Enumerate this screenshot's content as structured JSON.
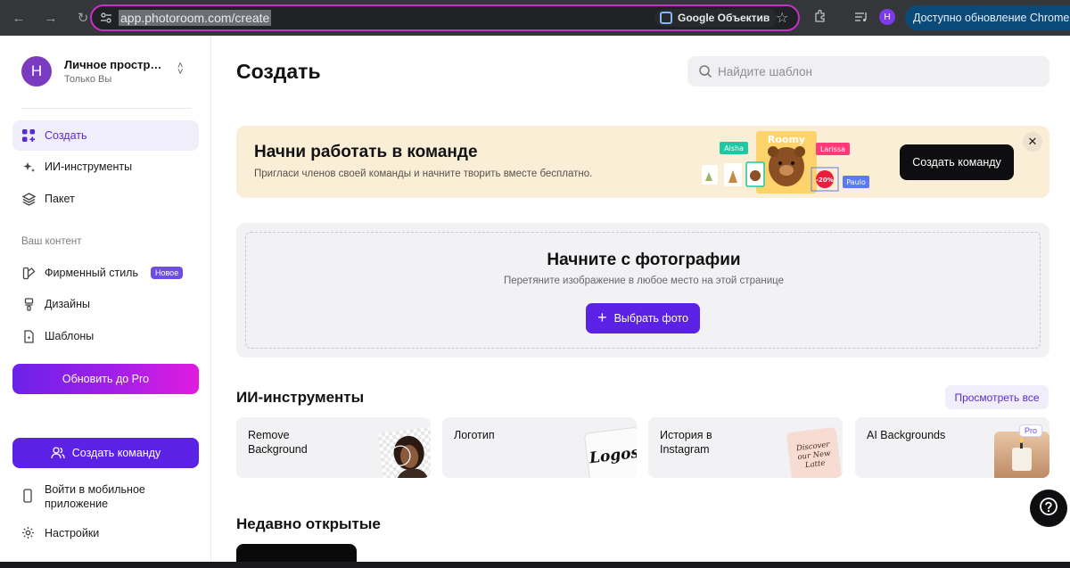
{
  "browser": {
    "url": "app.photoroom.com/create",
    "lens_label": "Google Объектив",
    "update_label": "Доступно обновление Chrome",
    "profile_initial": "H"
  },
  "workspace": {
    "avatar_initial": "H",
    "name": "Личное пространство",
    "sub": "Только Вы"
  },
  "sidebar": {
    "items": [
      {
        "label": "Создать"
      },
      {
        "label": "ИИ-инструменты"
      },
      {
        "label": "Пакет"
      }
    ],
    "content_section_label": "Ваш контент",
    "content_items": [
      {
        "label": "Фирменный стиль",
        "badge": "Новое"
      },
      {
        "label": "Дизайны"
      },
      {
        "label": "Шаблоны"
      }
    ],
    "upgrade_label": "Обновить до Pro",
    "create_team_label": "Создать команду",
    "mobile_label": "Войти в мобильное приложение",
    "settings_label": "Настройки"
  },
  "main": {
    "title": "Создать",
    "search_placeholder": "Найдите шаблон",
    "promo": {
      "title": "Начни работать в команде",
      "subtitle": "Пригласи членов своей команды и начните творить вместе бесплатно.",
      "button": "Создать команду",
      "illustration_tags": [
        "Aisha",
        "Larissa",
        "Paulo",
        "-20%",
        "Roomy"
      ]
    },
    "upload": {
      "title": "Начните с фотографии",
      "subtitle": "Перетяните изображение в любое место на этой странице",
      "button": "Выбрать фото"
    },
    "ai_tools": {
      "title": "ИИ-инструменты",
      "view_all": "Просмотреть все",
      "cards": [
        {
          "label": "Remove Background"
        },
        {
          "label": "Логотип",
          "thumb_text": "Logos"
        },
        {
          "label": "История в Instagram",
          "thumb_text": "Discover our New Latte"
        },
        {
          "label": "AI Backgrounds",
          "badge": "Pro"
        }
      ]
    },
    "recent": {
      "title": "Недавно открытые"
    }
  },
  "colors": {
    "accent": "#5b22e6",
    "promo_bg": "#fbeed6",
    "omnibox_border": "#c830c8"
  }
}
